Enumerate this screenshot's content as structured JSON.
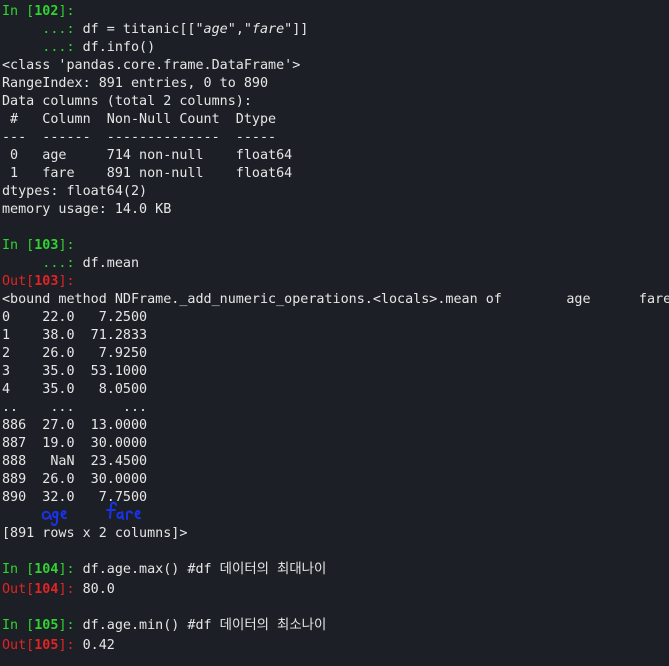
{
  "colors": {
    "background": "#1c1f25",
    "input_prompt": "#2fd52f",
    "output_prompt": "#e22424",
    "text": "#e6e6e6",
    "handwriting": "#1a32e6"
  },
  "cells": {
    "c102": {
      "in_open": "In [",
      "num": "102",
      "in_close": "]: ",
      "line1_code_a": "df = titanic[[",
      "line1_str1": "\"age\"",
      "line1_comma": ",",
      "line1_str2": "\"fare\"",
      "line1_code_b": "]]",
      "cont": "     ...: ",
      "line2_code": "df.info()",
      "output": [
        "<class 'pandas.core.frame.DataFrame'>",
        "RangeIndex: 891 entries, 0 to 890",
        "Data columns (total 2 columns):",
        " #   Column  Non-Null Count  Dtype  ",
        "---  ------  --------------  -----  ",
        " 0   age     714 non-null    float64",
        " 1   fare    891 non-null    float64",
        "dtypes: float64(2)",
        "memory usage: 14.0 KB"
      ]
    },
    "c103": {
      "in_open": "In [",
      "num": "103",
      "in_close": "]:",
      "cont": "     ...: ",
      "code": "df.mean",
      "out_open": "Out[",
      "out_close": "]:",
      "output": [
        "<bound method NDFrame._add_numeric_operations.<locals>.mean of        age      fare",
        "0    22.0   7.2500",
        "1    38.0  71.2833",
        "2    26.0   7.9250",
        "3    35.0  53.1000",
        "4    35.0   8.0500",
        "..    ...      ...",
        "886  27.0  13.0000",
        "887  19.0  30.0000",
        "888   NaN  23.4500",
        "889  26.0  30.0000",
        "890  32.0   7.7500",
        "",
        "[891 rows x 2 columns]>"
      ]
    },
    "c104": {
      "in_open": "In [",
      "num": "104",
      "in_close": "]: ",
      "code": "df.age.max() #df 데이터의 최대나이",
      "out_open": "Out[",
      "out_close": "]: ",
      "result": "80.0"
    },
    "c105": {
      "in_open": "In [",
      "num": "105",
      "in_close": "]: ",
      "code": "df.age.min() #df 데이터의 최소나이",
      "out_open": "Out[",
      "out_close": "]: ",
      "result": "0.42"
    }
  },
  "annotation": {
    "word1": "age",
    "word2": "fare"
  }
}
